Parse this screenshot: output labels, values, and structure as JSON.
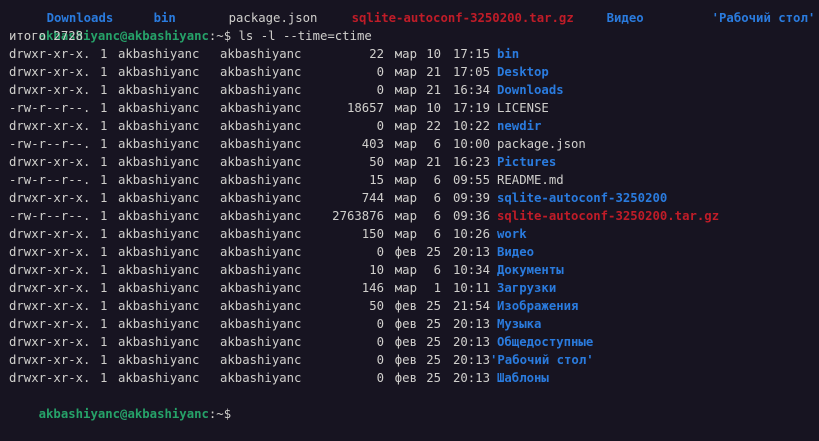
{
  "top_line": [
    {
      "text": "Downloads",
      "color": "blue"
    },
    {
      "text": "bin",
      "color": "blue"
    },
    {
      "text": "package.json",
      "color": "plain"
    },
    {
      "text": "sqlite-autoconf-3250200.tar.gz",
      "color": "red"
    },
    {
      "text": "Видео",
      "color": "blue"
    },
    {
      "text": "'Рабочий стол'",
      "color": "blue"
    }
  ],
  "prompt": {
    "user_host": "akbashiyanc@akbashiyanc",
    "path_suffix": ":~$ ",
    "command": "ls -l --time=ctime"
  },
  "total": "итого 2728",
  "entries": [
    {
      "perm": "drwxr-xr-x.",
      "links": "1",
      "user": "akbashiyanc",
      "group": "akbashiyanc",
      "size": "22",
      "month": "мар",
      "day": "10",
      "time": "17:15",
      "name": "bin",
      "kind": "dir"
    },
    {
      "perm": "drwxr-xr-x.",
      "links": "1",
      "user": "akbashiyanc",
      "group": "akbashiyanc",
      "size": "0",
      "month": "мар",
      "day": "21",
      "time": "17:05",
      "name": "Desktop",
      "kind": "dir"
    },
    {
      "perm": "drwxr-xr-x.",
      "links": "1",
      "user": "akbashiyanc",
      "group": "akbashiyanc",
      "size": "0",
      "month": "мар",
      "day": "21",
      "time": "16:34",
      "name": "Downloads",
      "kind": "dir"
    },
    {
      "perm": "-rw-r--r--.",
      "links": "1",
      "user": "akbashiyanc",
      "group": "akbashiyanc",
      "size": "18657",
      "month": "мар",
      "day": "10",
      "time": "17:19",
      "name": "LICENSE",
      "kind": "file"
    },
    {
      "perm": "drwxr-xr-x.",
      "links": "1",
      "user": "akbashiyanc",
      "group": "akbashiyanc",
      "size": "0",
      "month": "мар",
      "day": "22",
      "time": "10:22",
      "name": "newdir",
      "kind": "dir"
    },
    {
      "perm": "-rw-r--r--.",
      "links": "1",
      "user": "akbashiyanc",
      "group": "akbashiyanc",
      "size": "403",
      "month": "мар",
      "day": "6",
      "time": "10:00",
      "name": "package.json",
      "kind": "file"
    },
    {
      "perm": "drwxr-xr-x.",
      "links": "1",
      "user": "akbashiyanc",
      "group": "akbashiyanc",
      "size": "50",
      "month": "мар",
      "day": "21",
      "time": "16:23",
      "name": "Pictures",
      "kind": "dir"
    },
    {
      "perm": "-rw-r--r--.",
      "links": "1",
      "user": "akbashiyanc",
      "group": "akbashiyanc",
      "size": "15",
      "month": "мар",
      "day": "6",
      "time": "09:55",
      "name": "README.md",
      "kind": "file"
    },
    {
      "perm": "drwxr-xr-x.",
      "links": "1",
      "user": "akbashiyanc",
      "group": "akbashiyanc",
      "size": "744",
      "month": "мар",
      "day": "6",
      "time": "09:39",
      "name": "sqlite-autoconf-3250200",
      "kind": "dir"
    },
    {
      "perm": "-rw-r--r--.",
      "links": "1",
      "user": "akbashiyanc",
      "group": "akbashiyanc",
      "size": "2763876",
      "month": "мар",
      "day": "6",
      "time": "09:36",
      "name": "sqlite-autoconf-3250200.tar.gz",
      "kind": "archive"
    },
    {
      "perm": "drwxr-xr-x.",
      "links": "1",
      "user": "akbashiyanc",
      "group": "akbashiyanc",
      "size": "150",
      "month": "мар",
      "day": "6",
      "time": "10:26",
      "name": "work",
      "kind": "dir"
    },
    {
      "perm": "drwxr-xr-x.",
      "links": "1",
      "user": "akbashiyanc",
      "group": "akbashiyanc",
      "size": "0",
      "month": "фев",
      "day": "25",
      "time": "20:13",
      "name": "Видео",
      "kind": "dir"
    },
    {
      "perm": "drwxr-xr-x.",
      "links": "1",
      "user": "akbashiyanc",
      "group": "akbashiyanc",
      "size": "10",
      "month": "мар",
      "day": "6",
      "time": "10:34",
      "name": "Документы",
      "kind": "dir"
    },
    {
      "perm": "drwxr-xr-x.",
      "links": "1",
      "user": "akbashiyanc",
      "group": "akbashiyanc",
      "size": "146",
      "month": "мар",
      "day": "1",
      "time": "10:11",
      "name": "Загрузки",
      "kind": "dir"
    },
    {
      "perm": "drwxr-xr-x.",
      "links": "1",
      "user": "akbashiyanc",
      "group": "akbashiyanc",
      "size": "50",
      "month": "фев",
      "day": "25",
      "time": "21:54",
      "name": "Изображения",
      "kind": "dir"
    },
    {
      "perm": "drwxr-xr-x.",
      "links": "1",
      "user": "akbashiyanc",
      "group": "akbashiyanc",
      "size": "0",
      "month": "фев",
      "day": "25",
      "time": "20:13",
      "name": "Музыка",
      "kind": "dir"
    },
    {
      "perm": "drwxr-xr-x.",
      "links": "1",
      "user": "akbashiyanc",
      "group": "akbashiyanc",
      "size": "0",
      "month": "фев",
      "day": "25",
      "time": "20:13",
      "name": "Общедоступные",
      "kind": "dir"
    },
    {
      "perm": "drwxr-xr-x.",
      "links": "1",
      "user": "akbashiyanc",
      "group": "akbashiyanc",
      "size": "0",
      "month": "фев",
      "day": "25",
      "time": "20:13",
      "name": "'Рабочий стол'",
      "kind": "dir"
    },
    {
      "perm": "drwxr-xr-x.",
      "links": "1",
      "user": "akbashiyanc",
      "group": "akbashiyanc",
      "size": "0",
      "month": "фев",
      "day": "25",
      "time": "20:13",
      "name": "Шаблоны",
      "kind": "dir"
    }
  ],
  "final_prompt": {
    "user_host": "akbashiyanc@akbashiyanc",
    "path_suffix": ":~$ "
  },
  "colors": {
    "background": "#171421",
    "text": "#d0cfcc",
    "directory": "#2a7bde",
    "archive": "#c01c28",
    "prompt": "#26a269"
  }
}
